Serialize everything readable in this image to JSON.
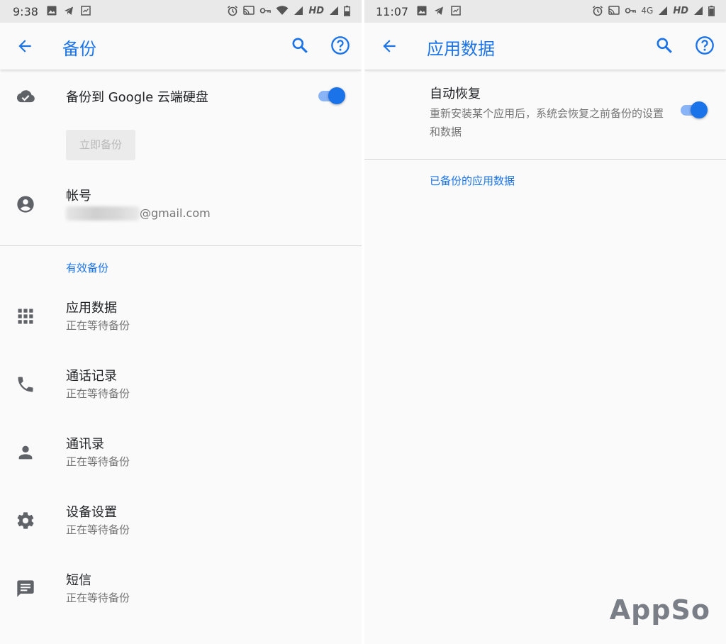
{
  "left": {
    "status": {
      "time": "9:38",
      "network": "HD"
    },
    "appbar": {
      "title": "备份"
    },
    "backup_drive": {
      "label": "备份到 Google 云端硬盘",
      "enabled": true
    },
    "backup_now": {
      "label": "立即备份"
    },
    "account": {
      "label": "帐号",
      "email_suffix": "@gmail.com"
    },
    "section_header": "有效备份",
    "items": [
      {
        "title": "应用数据",
        "status": "正在等待备份",
        "icon": "apps-grid-icon"
      },
      {
        "title": "通话记录",
        "status": "正在等待备份",
        "icon": "phone-icon"
      },
      {
        "title": "通讯录",
        "status": "正在等待备份",
        "icon": "person-icon"
      },
      {
        "title": "设备设置",
        "status": "正在等待备份",
        "icon": "gear-icon"
      },
      {
        "title": "短信",
        "status": "正在等待备份",
        "icon": "message-icon"
      }
    ]
  },
  "right": {
    "status": {
      "time": "11:07",
      "network": "4G",
      "network2": "HD"
    },
    "appbar": {
      "title": "应用数据"
    },
    "auto_restore": {
      "title": "自动恢复",
      "description": "重新安装某个应用后，系统会恢复之前备份的设置和数据",
      "enabled": true
    },
    "backed_up_link": "已备份的应用数据"
  },
  "watermark": "AppSo",
  "colors": {
    "accent": "#1a73e8",
    "accent_light": "#8ab4f8",
    "icon": "#5f6368"
  }
}
